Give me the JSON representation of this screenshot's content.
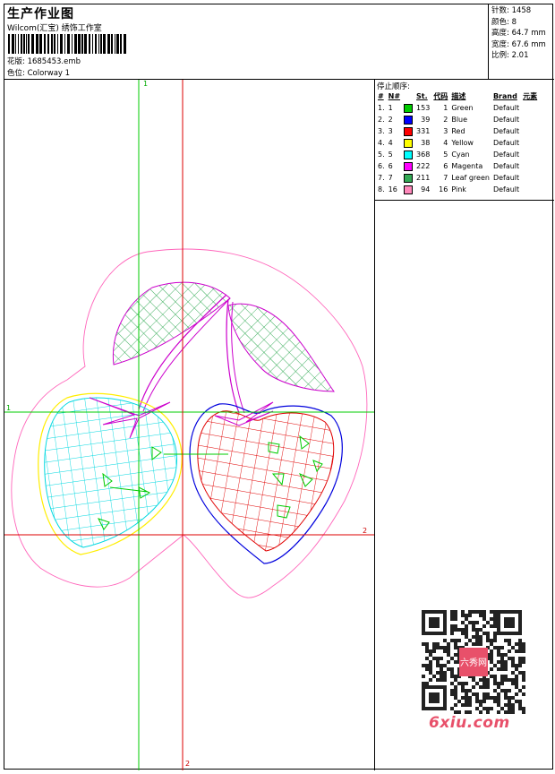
{
  "header": {
    "title": "生产作业图",
    "company": "Wilcom(汇宝) 绣饰工作室",
    "design_file": "花版: 1685453.emb",
    "colorway": "色位: Colorway 1"
  },
  "stats": {
    "stitches": "针数: 1458",
    "colors": "颜色: 8",
    "height": "高度: 64.7 mm",
    "width": "宽度: 67.6 mm",
    "scale": "比例: 2.01"
  },
  "stop_sequence": {
    "title": "停止顺序:",
    "columns": [
      "#",
      "N#",
      "St.",
      "代码",
      "描述",
      "Brand",
      "元素"
    ],
    "rows": [
      {
        "idx": "1.",
        "n": "1",
        "color": "#00cc00",
        "st": "153",
        "code": "1",
        "desc": "Green",
        "brand": "Default"
      },
      {
        "idx": "2.",
        "n": "2",
        "color": "#0000ff",
        "st": "39",
        "code": "2",
        "desc": "Blue",
        "brand": "Default"
      },
      {
        "idx": "3.",
        "n": "3",
        "color": "#ff0000",
        "st": "331",
        "code": "3",
        "desc": "Red",
        "brand": "Default"
      },
      {
        "idx": "4.",
        "n": "4",
        "color": "#ffff00",
        "st": "38",
        "code": "4",
        "desc": "Yellow",
        "brand": "Default"
      },
      {
        "idx": "5.",
        "n": "5",
        "color": "#00ffff",
        "st": "368",
        "code": "5",
        "desc": "Cyan",
        "brand": "Default"
      },
      {
        "idx": "6.",
        "n": "6",
        "color": "#ff00ff",
        "st": "222",
        "code": "6",
        "desc": "Magenta",
        "brand": "Default"
      },
      {
        "idx": "7.",
        "n": "7",
        "color": "#33aa55",
        "st": "211",
        "code": "7",
        "desc": "Leaf green",
        "brand": "Default"
      },
      {
        "idx": "8.",
        "n": "16",
        "color": "#ff88bb",
        "st": "94",
        "code": "16",
        "desc": "Pink",
        "brand": "Default"
      }
    ]
  },
  "guides": {
    "green_v": "1",
    "green_h": "1",
    "red_h": "2",
    "red_v": "2"
  },
  "watermark": {
    "text": "6xiu.com",
    "badge": "六秀网"
  }
}
